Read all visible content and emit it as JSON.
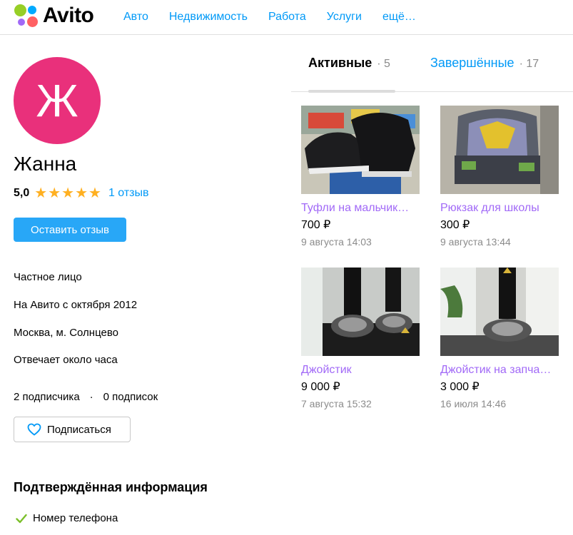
{
  "header": {
    "logo_text": "Avito",
    "nav": [
      "Авто",
      "Недвижимость",
      "Работа",
      "Услуги",
      "ещё…"
    ]
  },
  "profile": {
    "avatar_letter": "Ж",
    "name": "Жанна",
    "rating": "5,0",
    "stars": 5,
    "reviews_link": "1 отзыв",
    "review_button": "Оставить отзыв",
    "info": [
      "Частное лицо",
      "На Авито с октября 2012",
      "Москва, м. Солнцево",
      "Отвечает около часа"
    ],
    "followers": "2 подписчика",
    "separator": "·",
    "following": "0 подписок",
    "subscribe_button": "Подписаться",
    "verified_title": "Подтверждённая информация",
    "verified_items": [
      "Номер телефона"
    ]
  },
  "tabs": {
    "active_label": "Активные",
    "active_count": "· 5",
    "inactive_label": "Завершённые",
    "inactive_count": "· 17"
  },
  "listings": [
    {
      "title": "Туфли на мальчик…",
      "price": "700 ₽",
      "date": "9 августа 14:03",
      "image": "shoes-photo"
    },
    {
      "title": "Рюкзак для школы",
      "price": "300 ₽",
      "date": "9 августа 13:44",
      "image": "backpack-photo"
    },
    {
      "title": "Джойстик",
      "price": "9 000 ₽",
      "date": "7 августа 15:32",
      "image": "joystick-photo"
    },
    {
      "title": "Джойстик на запча…",
      "price": "3 000 ₽",
      "date": "16 июля 14:46",
      "image": "joystick-parts-photo"
    }
  ],
  "colors": {
    "avatar_bg": "#e9307b",
    "link": "#0099f7",
    "listing_title": "#a169f7",
    "star": "#ffb021",
    "button": "#28a7f7"
  }
}
